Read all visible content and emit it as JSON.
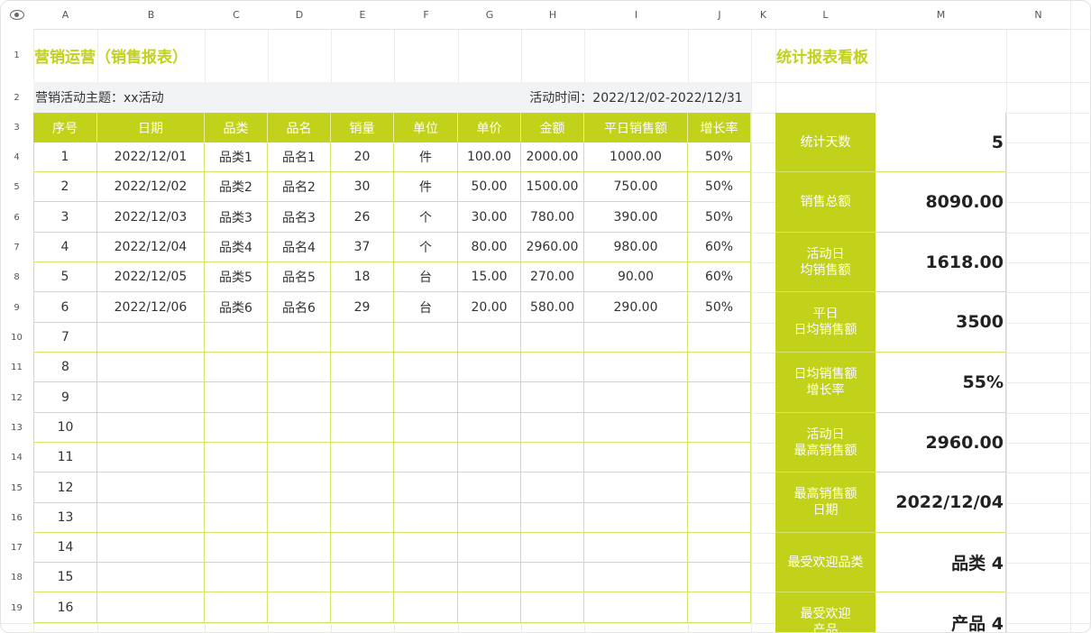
{
  "columns": [
    "A",
    "B",
    "C",
    "D",
    "E",
    "F",
    "G",
    "H",
    "I",
    "J",
    "K",
    "L",
    "M",
    "N"
  ],
  "rows": [
    "1",
    "2",
    "3",
    "4",
    "5",
    "6",
    "7",
    "8",
    "9",
    "10",
    "11",
    "12",
    "13",
    "14",
    "15",
    "16",
    "17",
    "18",
    "19"
  ],
  "report": {
    "title": "营销运营（销售报表）",
    "theme": "营销活动主题：xx活动",
    "period": "活动时间：2022/12/02-2022/12/31",
    "headers": [
      "序号",
      "日期",
      "品类",
      "品名",
      "销量",
      "单位",
      "单价",
      "金额",
      "平日销售额",
      "增长率"
    ],
    "data": [
      [
        "1",
        "2022/12/01",
        "品类1",
        "品名1",
        "20",
        "件",
        "100.00",
        "2000.00",
        "1000.00",
        "50%"
      ],
      [
        "2",
        "2022/12/02",
        "品类2",
        "品名2",
        "30",
        "件",
        "50.00",
        "1500.00",
        "750.00",
        "50%"
      ],
      [
        "3",
        "2022/12/03",
        "品类3",
        "品名3",
        "26",
        "个",
        "30.00",
        "780.00",
        "390.00",
        "50%"
      ],
      [
        "4",
        "2022/12/04",
        "品类4",
        "品名4",
        "37",
        "个",
        "80.00",
        "2960.00",
        "980.00",
        "60%"
      ],
      [
        "5",
        "2022/12/05",
        "品类5",
        "品名5",
        "18",
        "台",
        "15.00",
        "270.00",
        "90.00",
        "60%"
      ],
      [
        "6",
        "2022/12/06",
        "品类6",
        "品名6",
        "29",
        "台",
        "20.00",
        "580.00",
        "290.00",
        "50%"
      ]
    ],
    "extra_seq": [
      "7",
      "8",
      "9",
      "10",
      "11",
      "12",
      "13",
      "14",
      "15",
      "16"
    ]
  },
  "dashboard": {
    "title": "统计报表看板",
    "items": [
      {
        "label": "统计天数",
        "value": "5"
      },
      {
        "label": "销售总额",
        "value": "8090.00"
      },
      {
        "label": "活动日\n均销售额",
        "value": "1618.00"
      },
      {
        "label": "平日\n日均销售额",
        "value": "3500"
      },
      {
        "label": "日均销售额\n增长率",
        "value": "55%"
      },
      {
        "label": "活动日\n最高销售额",
        "value": "2960.00"
      },
      {
        "label": "最高销售额\n日期",
        "value": "2022/12/04"
      },
      {
        "label": "最受欢迎品类",
        "value": "品类 4"
      },
      {
        "label": "最受欢迎\n产品",
        "value": "产品 4"
      }
    ]
  },
  "colors": {
    "accent": "#c2d11a",
    "grid": "#ececec",
    "info_bg": "#f2f3f5"
  },
  "icons": {
    "corner": "eye-icon"
  }
}
